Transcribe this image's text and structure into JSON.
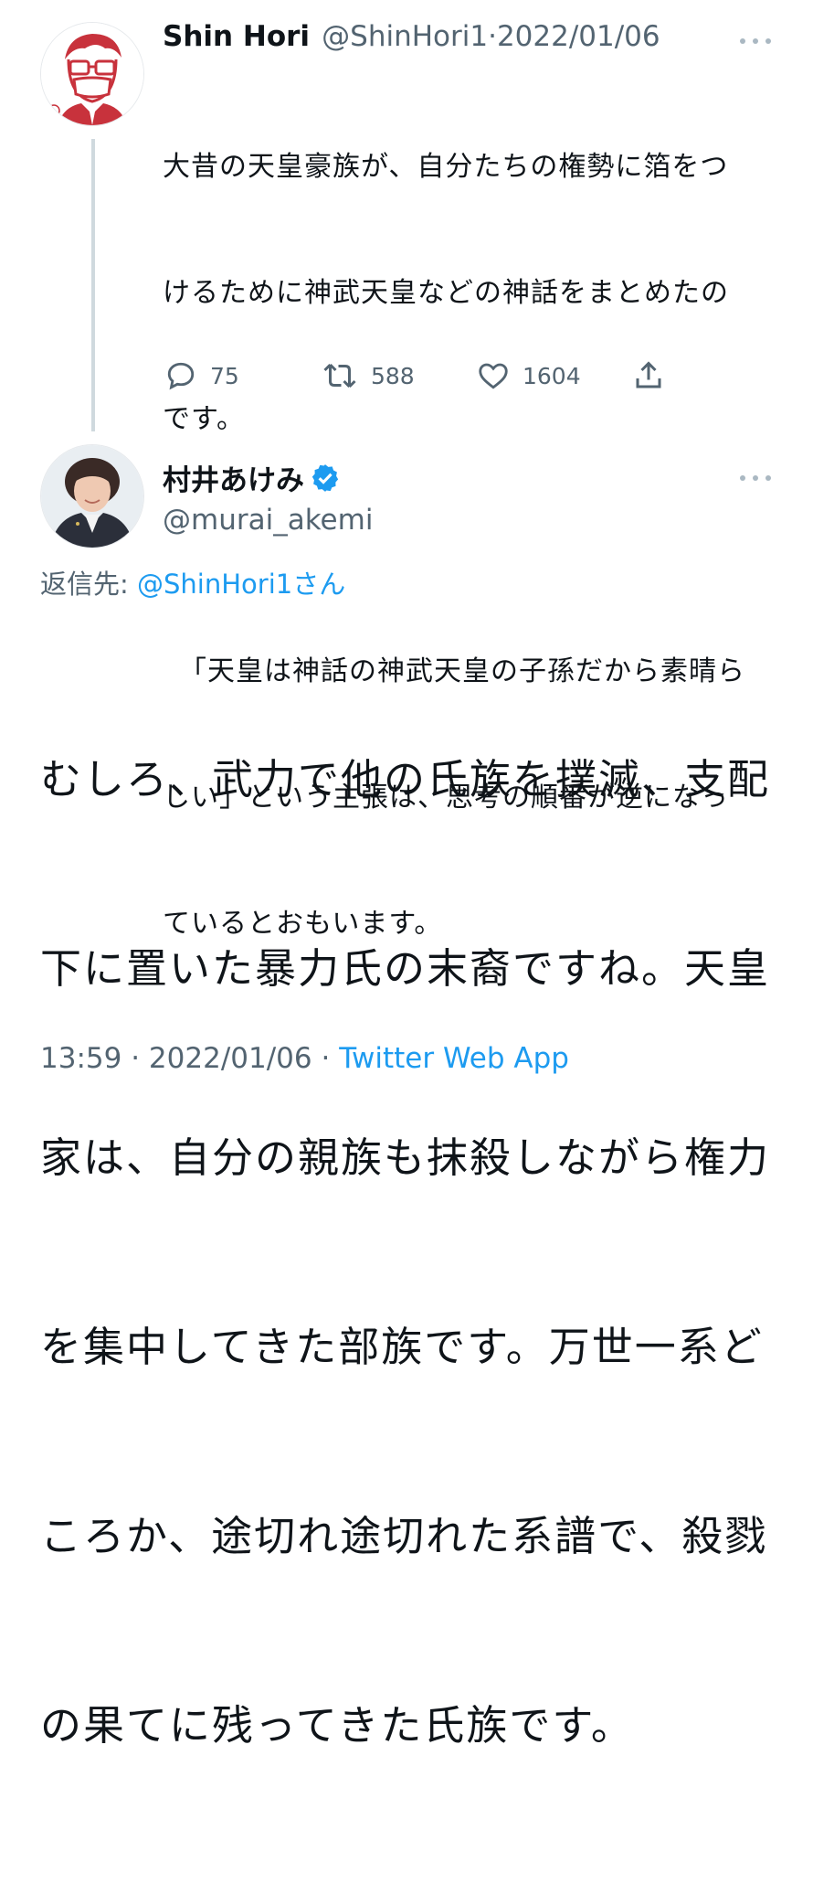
{
  "tweet1": {
    "author_name": "Shin Hori",
    "handle": "@ShinHori1",
    "separator": "·",
    "date": "2022/01/06",
    "body": "大昔の天皇豪族が、自分たちの権勢に箔をつけるために神武天皇などの神話をまとめたのです。\n\n「天皇は神話の神武天皇の子孫だから素晴らしい」という主張は、思考の順番が逆になっているとおもいます。",
    "body_lines": [
      "大昔の天皇豪族が、自分たちの権勢に箔をつ",
      "けるために神武天皇などの神話をまとめたの",
      "です。",
      "",
      "「天皇は神話の神武天皇の子孫だから素晴ら",
      "しい」という主張は、思考の順番が逆になっ",
      "ているとおもいます。"
    ],
    "actions": {
      "reply_icon": "reply-bubble-icon",
      "reply_count": "75",
      "retweet_icon": "retweet-icon",
      "retweet_count": "588",
      "like_icon": "heart-icon",
      "like_count": "1604",
      "share_icon": "share-icon"
    }
  },
  "tweet2": {
    "author_name": "村井あけみ",
    "verified_icon": "verified-badge-icon",
    "handle": "@murai_akemi",
    "reply_to_label": "返信先: ",
    "reply_to_mention": "@ShinHori1さん",
    "body": "むしろ、武力で他の氏族を撲滅、支配下に置いた暴力氏の末裔ですね。天皇家は、自分の親族も抹殺しながら権力を集中してきた部族です。万世一系どころか、途切れ途切れた系譜で、殺戮の果てに残ってきた氏族です。",
    "body_lines": [
      "むしろ、武力で他の氏族を撲滅、支配",
      "下に置いた暴力氏の末裔ですね。天皇",
      "家は、自分の親族も抹殺しながら権力",
      "を集中してきた部族です。万世一系ど",
      "ころか、途切れ途切れた系譜で、殺戮",
      "の果てに残ってきた氏族です。"
    ],
    "time": "13:59",
    "date": "2022/01/06",
    "separator": "·",
    "source": "Twitter Web App"
  },
  "colors": {
    "text": "#0f1419",
    "secondary": "#536471",
    "link": "#1d9bf0",
    "thread_line": "#cfd9de",
    "more_dots": "#aab8c2",
    "avatar1_accent": "#c8323c"
  }
}
